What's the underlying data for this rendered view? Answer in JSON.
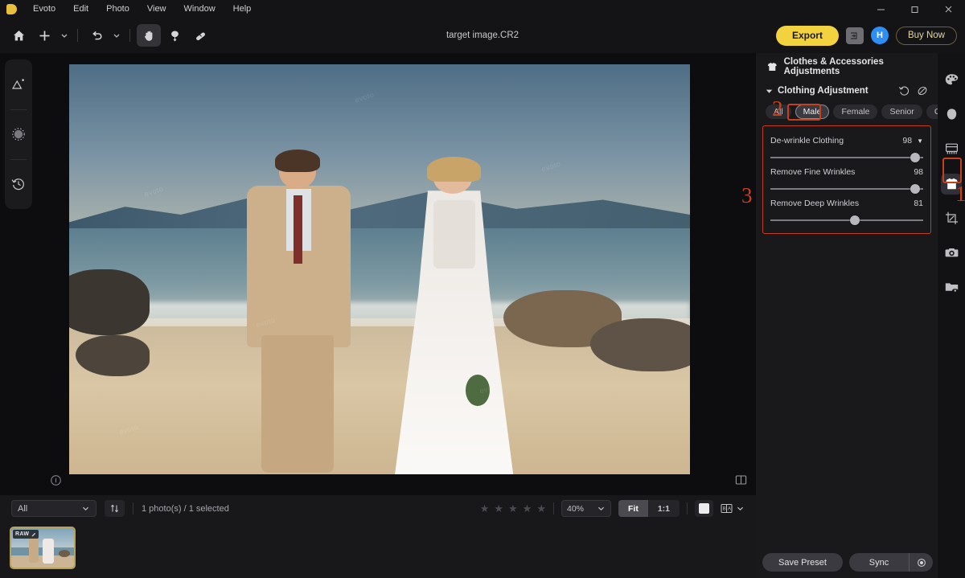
{
  "window": {
    "app_name": "Evoto",
    "title": "target image.CR2",
    "menu": [
      "Evoto",
      "Edit",
      "Photo",
      "View",
      "Window",
      "Help"
    ],
    "controls": [
      "minimize",
      "maximize",
      "close"
    ]
  },
  "toolbar": {
    "home_icon": "home-icon",
    "add_icon": "plus-icon",
    "add_chevron": "chevron-down-icon",
    "undo_icon": "undo-arrow-icon",
    "undo_chevron": "chevron-down-icon",
    "hand_icon": "hand-tool-icon",
    "retouch_icon": "spot-heal-icon",
    "brush_icon": "patch-tool-icon",
    "export_label": "Export",
    "export_side_icon": "export-panel-icon",
    "avatar_initial": "H",
    "buy_now_label": "Buy Now"
  },
  "left_rail": {
    "items": [
      {
        "name": "image-adjust-icon"
      },
      {
        "name": "brightness-icon"
      },
      {
        "name": "history-icon"
      }
    ]
  },
  "canvas": {
    "info_icon": "info-icon",
    "compare_icon": "split-view-icon",
    "watermarks": [
      "evoto",
      "evoto",
      "evoto",
      "evoto",
      "evoto",
      "evoto"
    ]
  },
  "bottom_bar": {
    "filter_value": "All",
    "filter_chevron": "chevron-down-icon",
    "sort_icon": "sort-icon",
    "photo_count": "1 photo(s) / 1 selected",
    "stars": 5,
    "zoom_value": "40%",
    "zoom_chevron": "chevron-down-icon",
    "fit_label": "Fit",
    "one_to_one_label": "1:1",
    "background_swatch_icon": "background-color-swatch",
    "before_after_icon": "before-after-icon",
    "before_after_chevron": "chevron-down-icon",
    "thumbnail": {
      "badge": "RAW",
      "edited_icon": "edited-pencil-icon"
    }
  },
  "right_panel": {
    "header_icon": "tshirt-icon",
    "header_title": "Clothes & Accessories Adjustments",
    "section": {
      "collapse_icon": "caret-down-icon",
      "title": "Clothing Adjustment",
      "reset_icon": "reset-icon",
      "mask_icon": "edit-mask-icon"
    },
    "chips": [
      {
        "label": "All",
        "selected": false
      },
      {
        "label": "Male",
        "selected": true
      },
      {
        "label": "Female",
        "selected": false
      },
      {
        "label": "Senior",
        "selected": false
      },
      {
        "label": "Child",
        "selected": false
      }
    ],
    "sliders": [
      {
        "label": "De-wrinkle Clothing",
        "value": 98,
        "percent": 98,
        "has_caret": true
      },
      {
        "label": "Remove Fine Wrinkles",
        "value": 98,
        "percent": 98,
        "has_caret": false
      },
      {
        "label": "Remove Deep Wrinkles",
        "value": 81,
        "percent": 55,
        "has_caret": false
      }
    ],
    "footer": {
      "save_preset_label": "Save Preset",
      "sync_label": "Sync",
      "sync_settings_icon": "gear-icon",
      "help_label": "?"
    }
  },
  "right_rail": {
    "items": [
      {
        "name": "color-palette-icon",
        "active": false
      },
      {
        "name": "face-retouch-icon",
        "active": false
      },
      {
        "name": "background-icon",
        "active": false
      },
      {
        "name": "clothes-icon",
        "active": true
      },
      {
        "name": "crop-icon",
        "active": false
      },
      {
        "name": "camera-icon",
        "active": false
      },
      {
        "name": "folder-preview-icon",
        "active": false
      }
    ]
  },
  "annotations": [
    {
      "number": "1"
    },
    {
      "number": "2"
    },
    {
      "number": "3"
    }
  ],
  "colors": {
    "accent_yellow": "#f2d23f",
    "annotation_red": "#c5401f",
    "avatar_blue": "#2d8ff5",
    "panel_bg": "#19191c"
  }
}
